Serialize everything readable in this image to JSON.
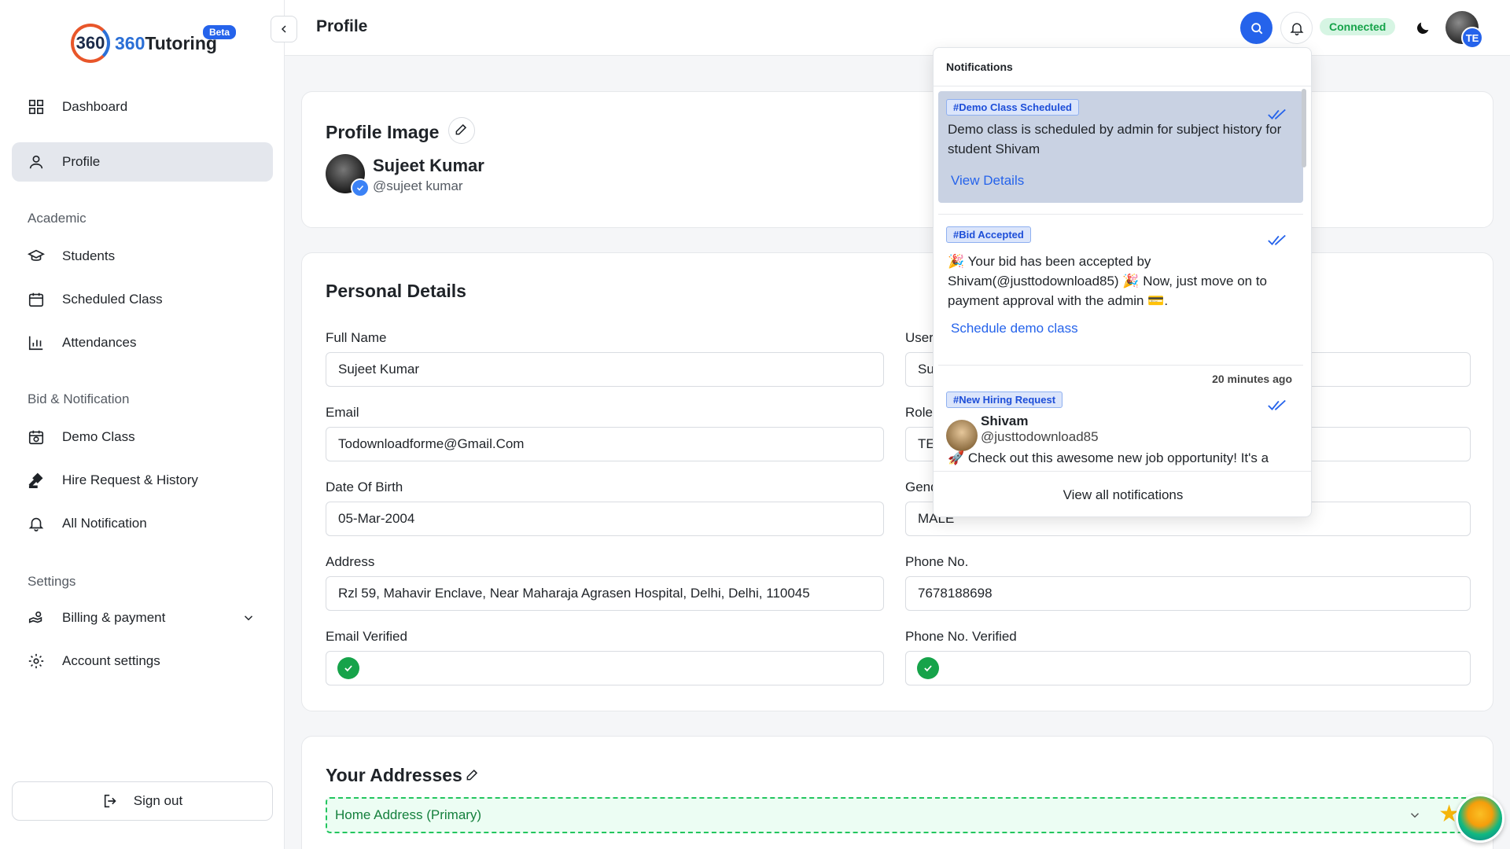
{
  "logo": {
    "mark": "360",
    "text_prefix": "360",
    "text_suffix": "Tutoring",
    "badge": "Beta"
  },
  "sidebar": {
    "dashboard": "Dashboard",
    "profile": "Profile",
    "academic_section": "Academic",
    "students": "Students",
    "scheduled_class": "Scheduled Class",
    "attendances": "Attendances",
    "bid_section": "Bid & Notification",
    "demo_class": "Demo Class",
    "hire_request": "Hire Request & History",
    "all_notification": "All Notification",
    "settings_section": "Settings",
    "billing": "Billing & payment",
    "account_settings": "Account settings",
    "sign_out": "Sign out"
  },
  "header": {
    "title": "Profile",
    "status": "Connected",
    "user_initials": "TE"
  },
  "profile_image": {
    "title": "Profile Image",
    "name": "Sujeet Kumar",
    "username": "@sujeet kumar"
  },
  "personal": {
    "title": "Personal Details",
    "full_name_label": "Full Name",
    "full_name": "Sujeet Kumar",
    "username_label": "User",
    "username_value": "Su",
    "email_label": "Email",
    "email": "Todownloadforme@Gmail.Com",
    "role_label": "Role",
    "role_value": "TE",
    "dob_label": "Date Of Birth",
    "dob": "05-Mar-2004",
    "gender_label": "Gend",
    "gender": "MALE",
    "address_label": "Address",
    "address": "Rzl 59, Mahavir Enclave, Near Maharaja Agrasen Hospital, Delhi, Delhi, 110045",
    "phone_label": "Phone No.",
    "phone": "7678188698",
    "email_verified_label": "Email Verified",
    "phone_verified_label": "Phone No. Verified"
  },
  "addresses": {
    "title": "Your Addresses",
    "primary": "Home Address (Primary)"
  },
  "notifications": {
    "title": "Notifications",
    "items": [
      {
        "tag": "#Demo Class Scheduled",
        "text": "Demo class is scheduled by admin for subject history for student Shivam",
        "link": "View Details"
      },
      {
        "tag": "#Bid Accepted",
        "text": "🎉 Your bid has been accepted by Shivam(@justtodownload85) 🎉 Now, just move on to payment approval with the admin 💳.",
        "link": "Schedule demo class"
      },
      {
        "time": "20 minutes ago",
        "tag": "#New Hiring Request",
        "name": "Shivam",
        "handle": "@justtodownload85",
        "text": "🚀 Check out this awesome new job opportunity! It's a"
      }
    ],
    "footer": "View all notifications"
  },
  "colors": {
    "accent": "#2563eb",
    "success": "#16a34a",
    "selected": "#c9d2e3"
  }
}
